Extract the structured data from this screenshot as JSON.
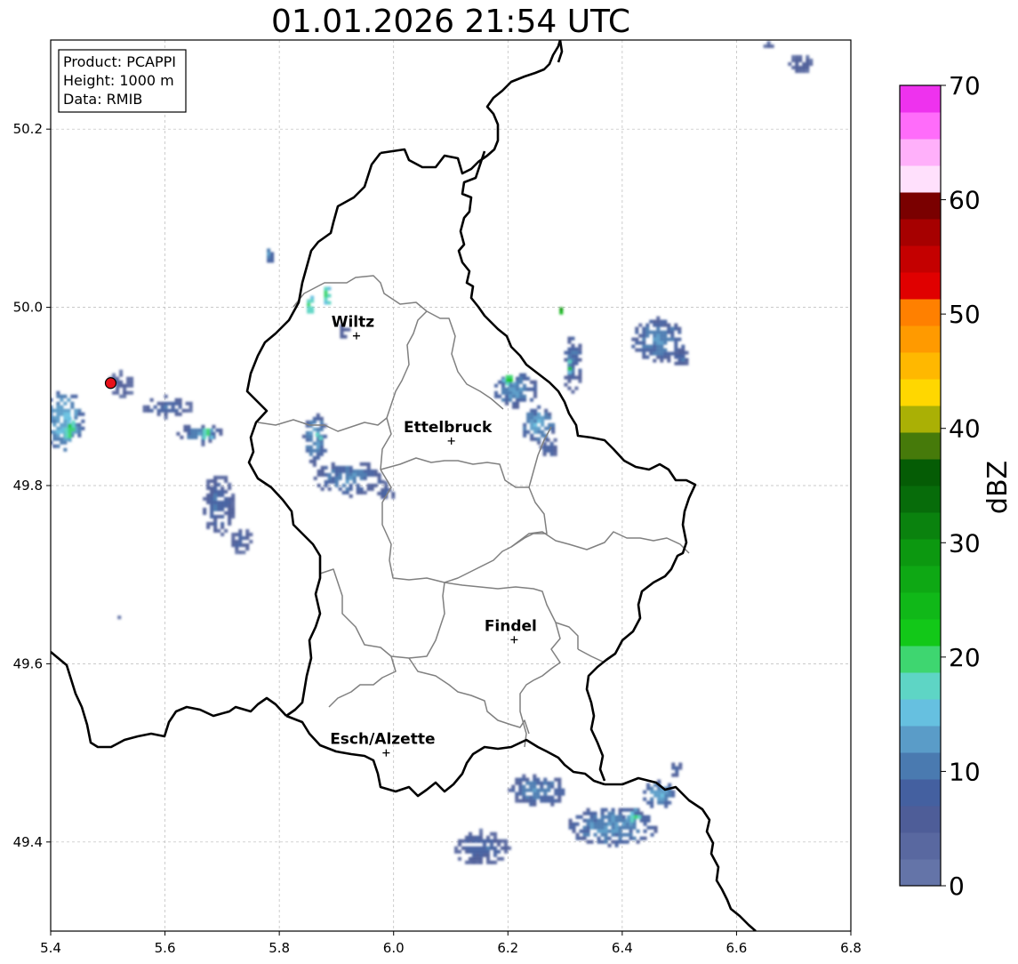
{
  "title": "01.01.2026 21:54 UTC",
  "info_box": {
    "product": "Product: PCAPPI",
    "height": "Height: 1000 m",
    "data": "Data: RMIB"
  },
  "axes": {
    "lon_range": [
      5.4,
      6.8
    ],
    "lat_range": [
      49.3,
      50.3
    ],
    "lon_ticks": [
      "5.4",
      "5.6",
      "5.8",
      "6.0",
      "6.2",
      "6.4",
      "6.6",
      "6.8"
    ],
    "lat_ticks": [
      "49.4",
      "49.6",
      "49.8",
      "50.0",
      "50.2"
    ],
    "grid": true
  },
  "places": [
    {
      "name": "Wiltz",
      "lon": 5.935,
      "lat": 49.968
    },
    {
      "name": "Ettelbruck",
      "lon": 6.101,
      "lat": 49.85
    },
    {
      "name": "Findel",
      "lon": 6.211,
      "lat": 49.627
    },
    {
      "name": "Esch/Alzette",
      "lon": 5.987,
      "lat": 49.5
    }
  ],
  "radar_site": {
    "lon": 5.505,
    "lat": 49.915,
    "color": "#e8101a"
  },
  "colorbar": {
    "label": "dBZ",
    "min": 0,
    "max": 70,
    "tick_labels": [
      "0",
      "10",
      "20",
      "30",
      "40",
      "50",
      "60",
      "70"
    ],
    "colors": [
      "#6474a8",
      "#5968a0",
      "#4e5d98",
      "#4460a0",
      "#4a7ab0",
      "#5a9cc8",
      "#66c0e0",
      "#5ed5c5",
      "#3ed670",
      "#12c818",
      "#10b818",
      "#0ea814",
      "#0c9810",
      "#0a820e",
      "#076c0a",
      "#055c05",
      "#467a0a",
      "#aab005",
      "#ffd700",
      "#ffb800",
      "#ff9a00",
      "#ff8000",
      "#e00000",
      "#c40000",
      "#a60000",
      "#7a0000",
      "#ffe0fc",
      "#ffb0fa",
      "#ff6cfa",
      "#ee32ee"
    ]
  },
  "precipitation_cells": [
    {
      "lon": 5.42,
      "lat": 49.875,
      "rlon": 0.035,
      "rlat": 0.035,
      "dbz": 14
    },
    {
      "lon": 5.43,
      "lat": 49.865,
      "rlon": 0.012,
      "rlat": 0.012,
      "dbz": 21
    },
    {
      "lon": 5.52,
      "lat": 49.915,
      "rlon": 0.025,
      "rlat": 0.015,
      "dbz": 6
    },
    {
      "lon": 5.6,
      "lat": 49.89,
      "rlon": 0.045,
      "rlat": 0.012,
      "dbz": 9
    },
    {
      "lon": 5.66,
      "lat": 49.86,
      "rlon": 0.04,
      "rlat": 0.012,
      "dbz": 11
    },
    {
      "lon": 5.67,
      "lat": 49.86,
      "rlon": 0.01,
      "rlat": 0.008,
      "dbz": 20
    },
    {
      "lon": 5.69,
      "lat": 49.78,
      "rlon": 0.03,
      "rlat": 0.035,
      "dbz": 9
    },
    {
      "lon": 5.73,
      "lat": 49.74,
      "rlon": 0.02,
      "rlat": 0.015,
      "dbz": 8
    },
    {
      "lon": 5.86,
      "lat": 49.855,
      "rlon": 0.02,
      "rlat": 0.03,
      "dbz": 12
    },
    {
      "lon": 5.865,
      "lat": 49.855,
      "rlon": 0.008,
      "rlat": 0.008,
      "dbz": 20
    },
    {
      "lon": 5.92,
      "lat": 49.81,
      "rlon": 0.06,
      "rlat": 0.02,
      "dbz": 11
    },
    {
      "lon": 5.985,
      "lat": 49.795,
      "rlon": 0.02,
      "rlat": 0.01,
      "dbz": 8
    },
    {
      "lon": 5.91,
      "lat": 49.975,
      "rlon": 0.01,
      "rlat": 0.01,
      "dbz": 8
    },
    {
      "lon": 5.85,
      "lat": 50.005,
      "rlon": 0.008,
      "rlat": 0.012,
      "dbz": 20
    },
    {
      "lon": 5.88,
      "lat": 50.015,
      "rlon": 0.008,
      "rlat": 0.012,
      "dbz": 20
    },
    {
      "lon": 5.78,
      "lat": 50.06,
      "rlon": 0.008,
      "rlat": 0.01,
      "dbz": 12
    },
    {
      "lon": 6.21,
      "lat": 49.91,
      "rlon": 0.04,
      "rlat": 0.02,
      "dbz": 12
    },
    {
      "lon": 6.25,
      "lat": 49.87,
      "rlon": 0.03,
      "rlat": 0.02,
      "dbz": 13
    },
    {
      "lon": 6.2,
      "lat": 49.92,
      "rlon": 0.01,
      "rlat": 0.008,
      "dbz": 21
    },
    {
      "lon": 6.27,
      "lat": 49.845,
      "rlon": 0.015,
      "rlat": 0.012,
      "dbz": 9
    },
    {
      "lon": 6.31,
      "lat": 49.94,
      "rlon": 0.018,
      "rlat": 0.035,
      "dbz": 10
    },
    {
      "lon": 6.29,
      "lat": 50.0,
      "rlon": 0.006,
      "rlat": 0.008,
      "dbz": 28
    },
    {
      "lon": 6.305,
      "lat": 49.935,
      "rlon": 0.006,
      "rlat": 0.006,
      "dbz": 22
    },
    {
      "lon": 6.46,
      "lat": 49.965,
      "rlon": 0.05,
      "rlat": 0.025,
      "dbz": 11
    },
    {
      "lon": 6.5,
      "lat": 49.945,
      "rlon": 0.015,
      "rlat": 0.01,
      "dbz": 9
    },
    {
      "lon": 6.71,
      "lat": 50.275,
      "rlon": 0.02,
      "rlat": 0.012,
      "dbz": 7
    },
    {
      "lon": 6.655,
      "lat": 50.295,
      "rlon": 0.008,
      "rlat": 0.004,
      "dbz": 6
    },
    {
      "lon": 6.25,
      "lat": 49.46,
      "rlon": 0.05,
      "rlat": 0.02,
      "dbz": 11
    },
    {
      "lon": 6.15,
      "lat": 49.395,
      "rlon": 0.05,
      "rlat": 0.02,
      "dbz": 9
    },
    {
      "lon": 6.38,
      "lat": 49.42,
      "rlon": 0.08,
      "rlat": 0.022,
      "dbz": 12
    },
    {
      "lon": 6.42,
      "lat": 49.43,
      "rlon": 0.012,
      "rlat": 0.008,
      "dbz": 20
    },
    {
      "lon": 6.46,
      "lat": 49.455,
      "rlon": 0.03,
      "rlat": 0.015,
      "dbz": 13
    },
    {
      "lon": 6.49,
      "lat": 49.485,
      "rlon": 0.01,
      "rlat": 0.012,
      "dbz": 9
    },
    {
      "lon": 5.52,
      "lat": 49.655,
      "rlon": 0.003,
      "rlat": 0.003,
      "dbz": 8
    }
  ]
}
